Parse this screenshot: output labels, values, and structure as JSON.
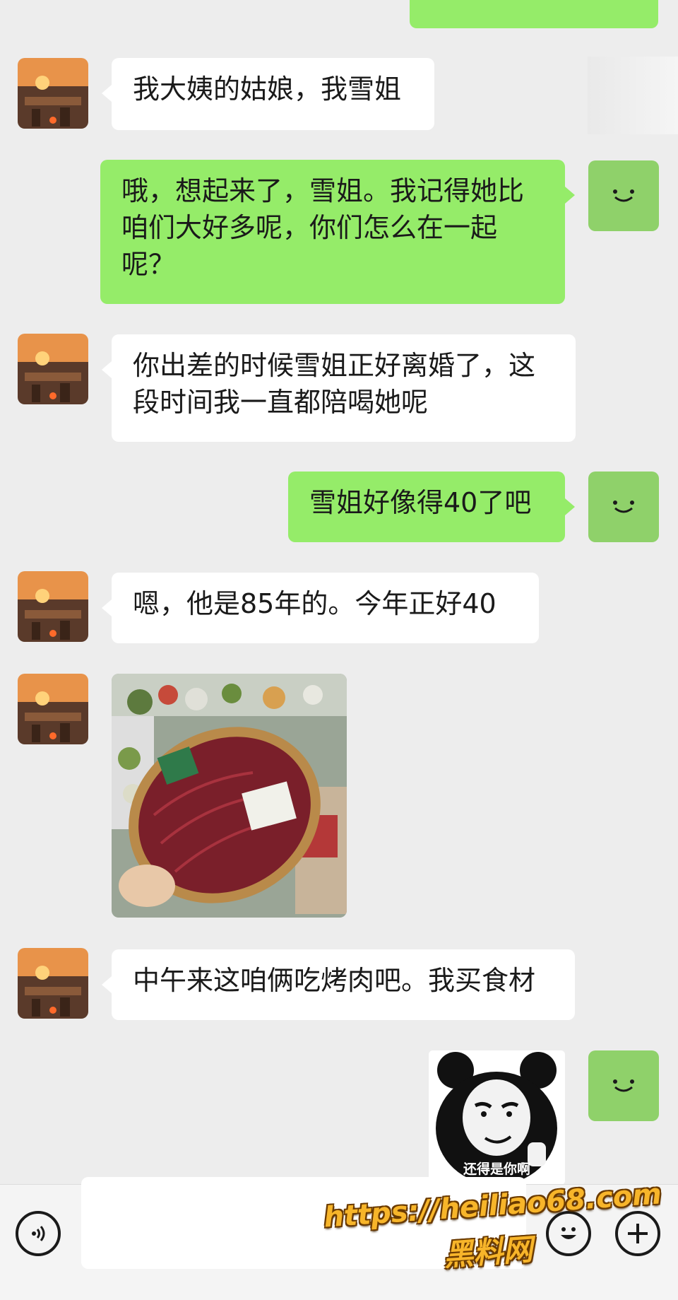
{
  "messages": [
    {
      "side": "left",
      "text": "我大姨的姑娘，我雪姐"
    },
    {
      "side": "right",
      "text": "哦，想起来了，雪姐。我记得她比\n咱们大好多呢，你们怎么在一起\n呢？"
    },
    {
      "side": "left",
      "text": "你出差的时候雪姐正好离婚了，这\n段时间我一直都陪喝她呢"
    },
    {
      "side": "right",
      "text": "雪姐好像得40了吧"
    },
    {
      "side": "left",
      "text": "嗯，他是85年的。今年正好40"
    },
    {
      "side": "left",
      "type": "image",
      "content": "photo-sliced-meat"
    },
    {
      "side": "left",
      "text": "中午来这咱俩吃烤肉吧。我买食材"
    },
    {
      "side": "right",
      "type": "sticker",
      "caption": "还得是你啊"
    }
  ],
  "photo_label": "",
  "input_bar": {
    "voice_icon": "voice-icon",
    "emoji_icon": "emoji-icon",
    "plus_icon": "plus-icon"
  },
  "watermark": {
    "url": "https://heiliao68.com",
    "name": "黑料网"
  },
  "colors": {
    "background": "#ededed",
    "sent_bubble": "#95ec69",
    "received_bubble": "#ffffff",
    "watermark": "#f7b52a"
  }
}
